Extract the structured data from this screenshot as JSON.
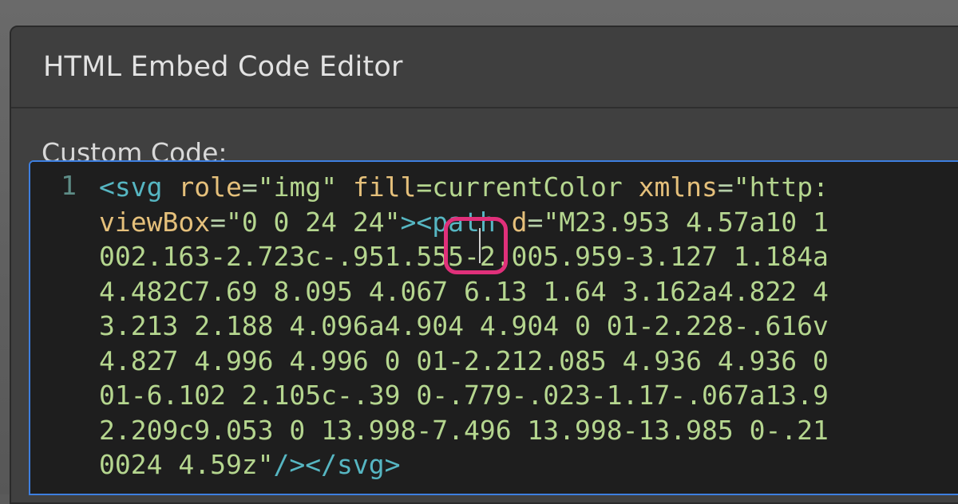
{
  "dialog": {
    "title": "HTML Embed Code Editor",
    "field_label": "Custom Code:"
  },
  "editor": {
    "line_number": "1",
    "lines": [
      [
        {
          "t": "<svg",
          "c": "tag"
        },
        {
          "t": " ",
          "c": "eq"
        },
        {
          "t": "role",
          "c": "attr"
        },
        {
          "t": "=",
          "c": "eq"
        },
        {
          "t": "\"img\"",
          "c": "str"
        },
        {
          "t": " ",
          "c": "eq"
        },
        {
          "t": "fill",
          "c": "attr"
        },
        {
          "t": "=currentColor ",
          "c": "str"
        },
        {
          "t": "xmlns",
          "c": "attr"
        },
        {
          "t": "=",
          "c": "eq"
        },
        {
          "t": "\"http:",
          "c": "str"
        }
      ],
      [
        {
          "t": "viewBox",
          "c": "attr"
        },
        {
          "t": "=",
          "c": "eq"
        },
        {
          "t": "\"0 0 24 24\"",
          "c": "str"
        },
        {
          "t": "><path",
          "c": "tag"
        },
        {
          "t": " ",
          "c": "eq"
        },
        {
          "t": "d",
          "c": "attr"
        },
        {
          "t": "=",
          "c": "eq"
        },
        {
          "t": "\"M23.953 4.57a10 1",
          "c": "str"
        }
      ],
      [
        {
          "t": "002.163-2.723c-.951.555-2.005.959-3.127 1.184a",
          "c": "str"
        }
      ],
      [
        {
          "t": "4.482C7.69 8.095 4.067 6.13 1.64 3.162a4.822 4",
          "c": "str"
        }
      ],
      [
        {
          "t": "3.213 2.188 4.096a4.904 4.904 0 01-2.228-.616v",
          "c": "str"
        }
      ],
      [
        {
          "t": "4.827 4.996 4.996 0 01-2.212.085 4.936 4.936 0",
          "c": "str"
        }
      ],
      [
        {
          "t": "01-6.102 2.105c-.39 0-.779-.023-1.17-.067a13.9",
          "c": "str"
        }
      ],
      [
        {
          "t": "2.209c9.053 0 13.998-7.496 13.998-13.985 0-.21",
          "c": "str"
        }
      ],
      [
        {
          "t": "0024 4.59z\"",
          "c": "str"
        },
        {
          "t": "/></svg>",
          "c": "tag"
        }
      ]
    ]
  }
}
